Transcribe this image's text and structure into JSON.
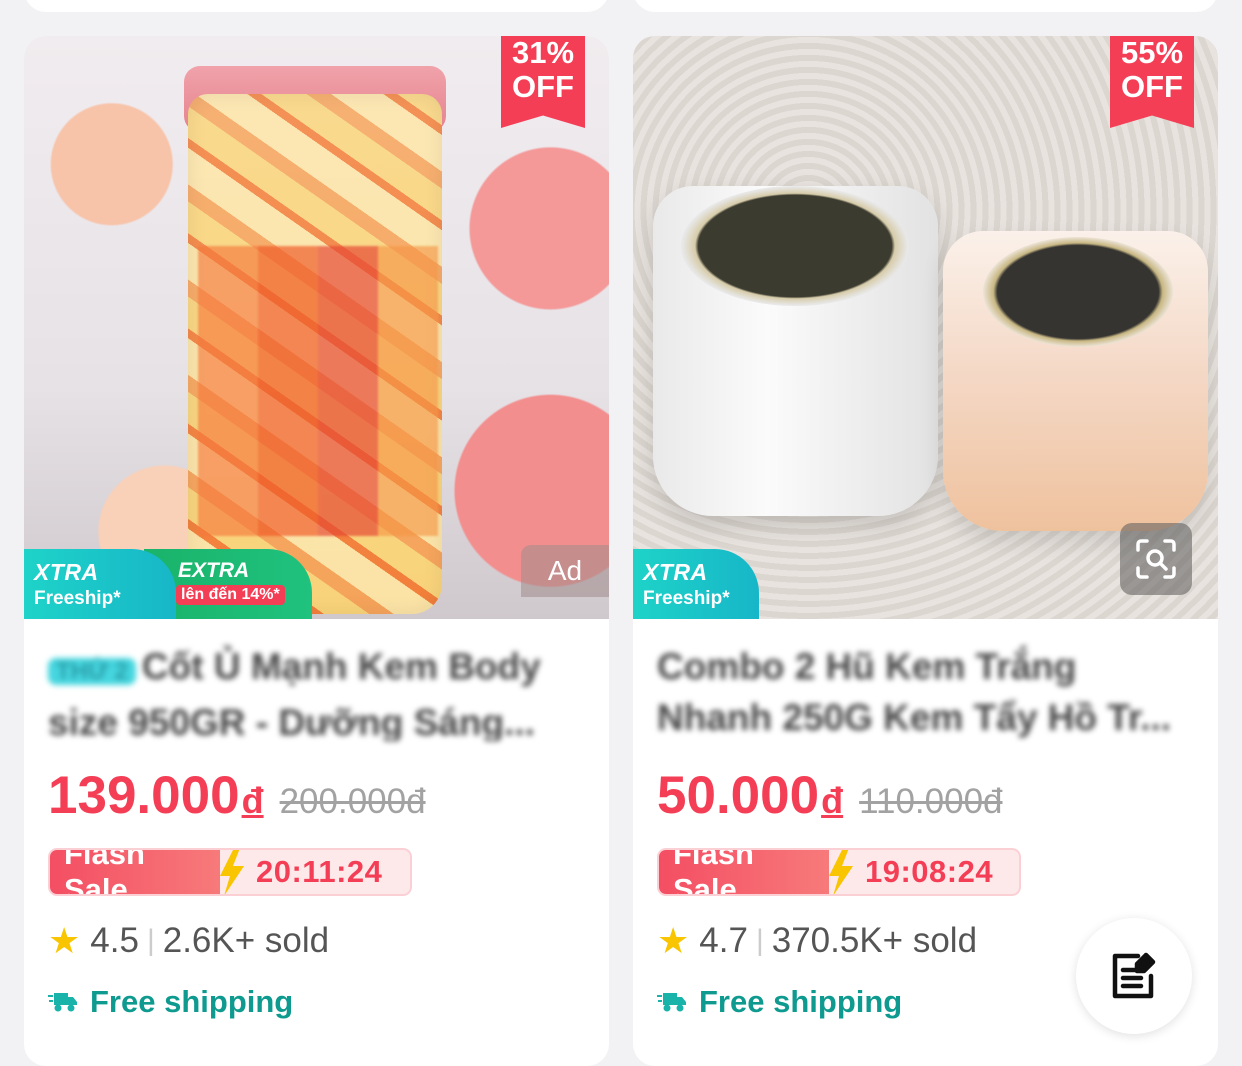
{
  "products": [
    {
      "discount_pct": "31%",
      "discount_off": "OFF",
      "xtra_line1": "XTRA",
      "xtra_line2": "Freeship*",
      "extra_line1": "EXTRA",
      "extra_line2": "lên đến 14%*",
      "ad_label": "Ad",
      "title_tag": "THỨ 2",
      "title": "Cốt Ủ Mạnh Kem Body size 950GR - Dưỡng Sáng...",
      "price": "139.000",
      "currency": "đ",
      "original_price": "200.000đ",
      "flash_label": "Flash Sale",
      "flash_timer": "20:11:24",
      "rating": "4.5",
      "sold": "2.6K+ sold",
      "shipping": "Free shipping"
    },
    {
      "discount_pct": "55%",
      "discount_off": "OFF",
      "xtra_line1": "XTRA",
      "xtra_line2": "Freeship*",
      "title": "Combo 2 Hũ Kem Trắng Nhanh 250G Kem Tẩy Hồ Tr...",
      "price": "50.000",
      "currency": "đ",
      "original_price": "110.000đ",
      "flash_label": "Flash Sale",
      "flash_timer": "19:08:24",
      "rating": "4.7",
      "sold": "370.5K+ sold",
      "shipping": "Free shipping"
    }
  ],
  "icons": {
    "rating": "star-icon",
    "shipping": "truck-icon",
    "flash": "lightning-icon",
    "image_search": "image-search-icon",
    "fab": "edit-note-icon"
  },
  "colors": {
    "accent_red": "#f43e55",
    "teal": "#17b6c8",
    "green": "#1ab36a",
    "shipping_green": "#0f9a90",
    "star": "#f9c400"
  }
}
